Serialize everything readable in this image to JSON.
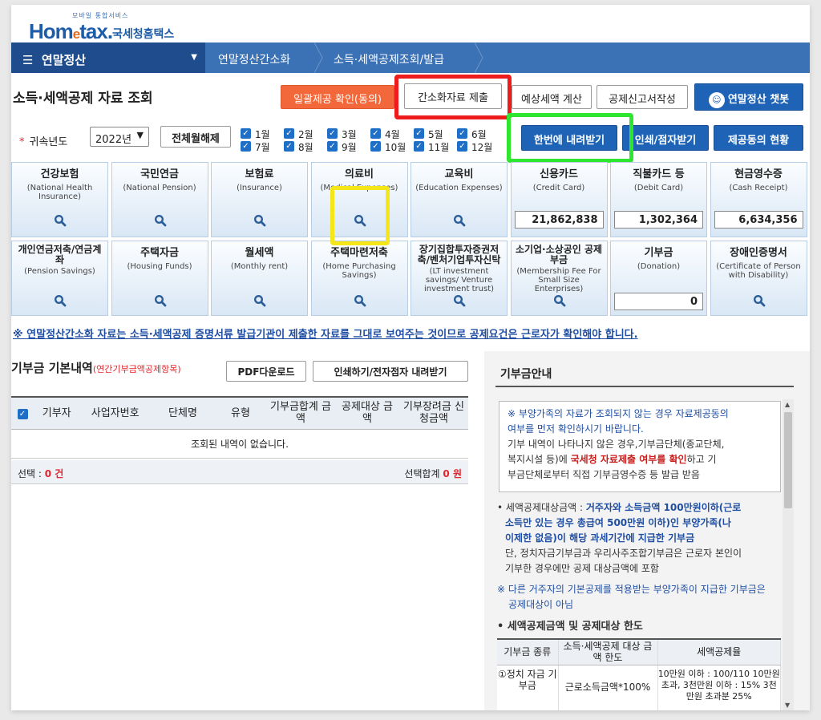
{
  "logo": {
    "tagline": "모바일 통합서비스",
    "brand_home": "Hom",
    "brand_e": "e",
    "brand_tax": "tax.",
    "org": "국세청홈택스"
  },
  "nav": {
    "menu": "연말정산",
    "crumbs": [
      "연말정산간소화",
      "소득·세액공제조회/발급"
    ]
  },
  "page_title": "소득·세액공제 자료 조회",
  "buttons": {
    "bulk_confirm": "일괄제공 확인(동의)",
    "submit_simplified": "간소화자료 제출",
    "estimate_tax": "예상세액 계산",
    "deduction_form": "공제신고서작성",
    "chatbot": "연말정산 챗봇",
    "download_all": "한번에 내려받기",
    "print_download": "인쇄/점자받기",
    "provision_status": "제공동의 현황",
    "clear_all": "전체월해제"
  },
  "year": {
    "label": "귀속년도",
    "value": "2022년"
  },
  "months": [
    "1월",
    "2월",
    "3월",
    "4월",
    "5월",
    "6월",
    "7월",
    "8월",
    "9월",
    "10월",
    "11월",
    "12월"
  ],
  "tiles": [
    {
      "ko": "건강보험",
      "en": "(National Health Insurance)"
    },
    {
      "ko": "국민연금",
      "en": "(National Pension)"
    },
    {
      "ko": "보험료",
      "en": "(Insurance)"
    },
    {
      "ko": "의료비",
      "en": "(Medical Expenses)"
    },
    {
      "ko": "교육비",
      "en": "(Education Expenses)"
    },
    {
      "ko": "신용카드",
      "en": "(Credit Card)",
      "amount": "21,862,838"
    },
    {
      "ko": "직불카드 등",
      "en": "(Debit Card)",
      "amount": "1,302,364"
    },
    {
      "ko": "현금영수증",
      "en": "(Cash Receipt)",
      "amount": "6,634,356"
    },
    {
      "ko": "개인연금저축/연금계좌",
      "en": "(Pension Savings)"
    },
    {
      "ko": "주택자금",
      "en": "(Housing Funds)"
    },
    {
      "ko": "월세액",
      "en": "(Monthly rent)"
    },
    {
      "ko": "주택마련저축",
      "en": "(Home Purchasing Savings)"
    },
    {
      "ko": "장기집합투자증권저축/벤처기업투자신탁",
      "en": "(LT investment savings/ Venture investment trust)"
    },
    {
      "ko": "소기업·소상공인 공제부금",
      "en": "(Membership Fee For Small Size Enterprises)"
    },
    {
      "ko": "기부금",
      "en": "(Donation)",
      "amount": "0"
    },
    {
      "ko": "장애인증명서",
      "en": "(Certificate of Person with Disability)"
    }
  ],
  "notice": "※ 연말정산간소화 자료는 소득·세액공제 증명서류 발급기관이 제출한 자료를 그대로 보여주는 것이므로 공제요건은 근로자가 확인해야 합니다.",
  "donation": {
    "title": "기부금 기본내역",
    "subtitle": "(연간기부금액공제항목)",
    "pdf_btn": "PDF다운로드",
    "print_btn": "인쇄하기/전자점자 내려받기",
    "columns": [
      "기부자",
      "사업자번호",
      "단체명",
      "유형",
      "기부금합계 금액",
      "공제대상 금액",
      "기부장려금 신청금액"
    ],
    "empty": "조회된 내역이 없습니다.",
    "selected_label": "선택 :",
    "selected_count": "0 건",
    "total_label": "선택합계",
    "total_value": "0 원"
  },
  "guide": {
    "title": "기부금안내",
    "box_line1": "※ 부양가족의 자료가 조회되지 않는 경우 자료제공동의",
    "box_line2": "여부를 먼저 확인하시기 바랍니다.",
    "box_line3": "기부 내역이 나타나지 않은 경우,기부금단체(종교단체,",
    "box_line4a": "복지시설 등)에 ",
    "box_line4b": "국세청 자료제출 여부를 확인",
    "box_line4c": "하고 기",
    "box_line5": "부금단체로부터 직접 기부금영수증 등 발급 받음",
    "p1_a": "• 세액공제대상금액 : ",
    "p1_b": "거주자와 소득금액 100만원이하(근로",
    "p1_c": "소득만 있는 경우 총급여 500만원 이하)인 부양가족(나",
    "p1_d": "이제한 없음)이 해당 과세기간에 지급한 기부금",
    "p1_e": "단, 정치자금기부금과 우리사주조합기부금은 근로자 본인이",
    "p1_f": "기부한 경우에만 공제 대상금액에 포함",
    "p2_a": "※ 다른 거주자의 기본공제를 적용받는 부양가족이 지급한 기부금은",
    "p2_b": "공제대상이 아님",
    "section": "• 세액공제금액 및 공제대상 한도",
    "tbl_cols": [
      "기부금 종류",
      "소득·세액공제 대상 금액 한도",
      "세액공제율"
    ],
    "tbl_row": [
      "①정치 자금 기부금",
      "근로소득금액*100%",
      "10만원 이하 : 100/110 10만원 초과, 3천만원 이하 : 15% 3천만원 초과분 25%"
    ]
  }
}
